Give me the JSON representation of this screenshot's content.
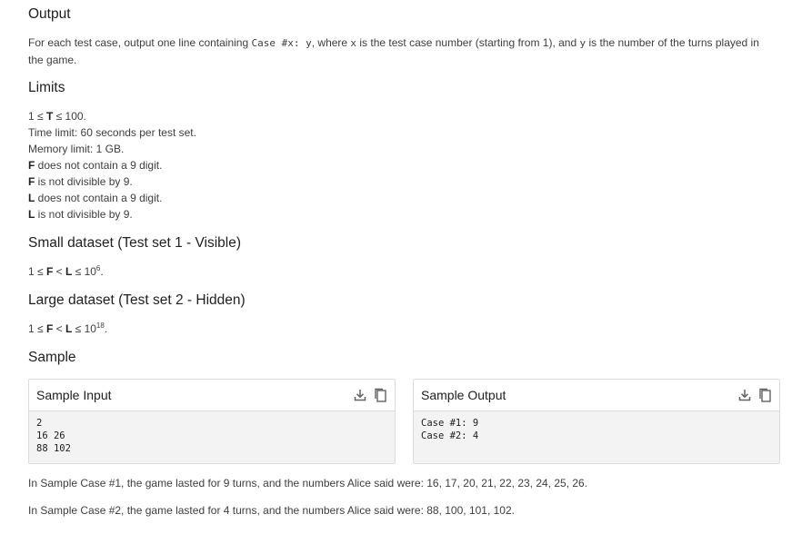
{
  "output": {
    "heading": "Output",
    "text_before": "For each test case, output one line containing ",
    "code_case": "Case #x: y",
    "text_middle1": ", where ",
    "var_x": "x",
    "text_middle2": " is the test case number (starting from 1), and ",
    "var_y": "y",
    "text_after": " is the number of the turns played in the game."
  },
  "limits": {
    "heading": "Limits",
    "t_prefix": "1 ≤ ",
    "t_var": "T",
    "t_suffix": " ≤ 100.",
    "time": "Time limit: 60 seconds per test set.",
    "memory": "Memory limit: 1 GB.",
    "items": [
      {
        "var": "F",
        "text": " does not contain a 9 digit."
      },
      {
        "var": "F",
        "text": " is not divisible by 9."
      },
      {
        "var": "L",
        "text": " does not contain a 9 digit."
      },
      {
        "var": "L",
        "text": " is not divisible by 9."
      }
    ]
  },
  "small": {
    "heading": "Small dataset (Test set 1 - Visible)",
    "prefix": "1 ≤ ",
    "f": "F",
    "lt": " < ",
    "l": "L",
    "le": " ≤ 10",
    "exp": "6",
    "end": "."
  },
  "large": {
    "heading": "Large dataset (Test set 2 - Hidden)",
    "prefix": "1 ≤ ",
    "f": "F",
    "lt": " < ",
    "l": "L",
    "le": " ≤ 10",
    "exp": "18",
    "end": "."
  },
  "sample": {
    "heading": "Sample",
    "input": {
      "title": "Sample Input",
      "lines": [
        "2",
        "16 26",
        "88 102"
      ]
    },
    "output": {
      "title": "Sample Output",
      "lines": [
        "Case #1: 9",
        "Case #2: 4"
      ]
    },
    "icons": [
      "download-icon",
      "copy-icon"
    ]
  },
  "explanations": {
    "case1": "In Sample Case #1, the game lasted for 9 turns, and the numbers Alice said were: 16, 17, 20, 21, 22, 23, 24, 25, 26.",
    "case2": "In Sample Case #2, the game lasted for 4 turns, and the numbers Alice said were: 88, 100, 101, 102."
  }
}
